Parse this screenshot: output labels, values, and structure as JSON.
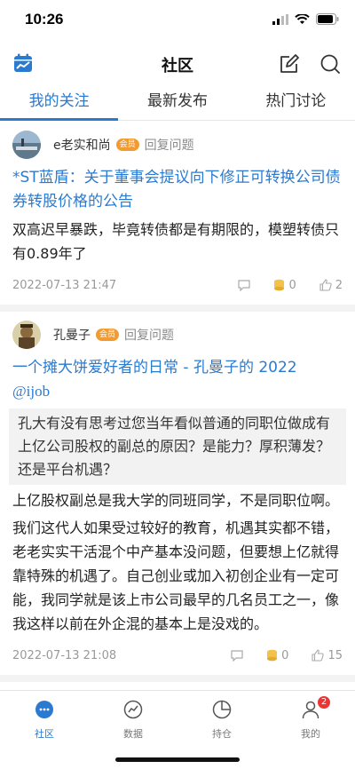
{
  "status_bar": {
    "time": "10:26"
  },
  "nav": {
    "title": "社区"
  },
  "tabs": [
    {
      "label": "我的关注",
      "active": true
    },
    {
      "label": "最新发布",
      "active": false
    },
    {
      "label": "热门讨论",
      "active": false
    }
  ],
  "posts": [
    {
      "author": "e老实和尚",
      "badge": "会员",
      "action": "回复问题",
      "title": "*ST蓝盾：关于董事会提议向下修正可转换公司债券转股价格的公告",
      "body": "双高迟早暴跌，毕竟转债都是有期限的，模塑转债只有0.89年了",
      "date": "2022-07-13 21:47",
      "coin_count": "0",
      "like_count": "2"
    },
    {
      "author": "孔曼子",
      "badge": "会员",
      "action": "回复问题",
      "title": "一个摊大饼爱好者的日常 - 孔曼子的 2022",
      "subtitle": "@ijob",
      "quote": "孔大有没有思考过您当年看似普通的同职位做成有上亿公司股权的副总的原因？是能力？厚积薄发？还是平台机遇？",
      "body1": "上亿股权副总是我大学的同班同学，不是同职位啊。",
      "body2": "我们这代人如果受过较好的教育，机遇其实都不错，老老实实干活混个中产基本没问题，但要想上亿就得靠特殊的机遇了。自己创业或加入初创企业有一定可能，我同学就是该上市公司最早的几名员工之一，像我这样以前在外企混的基本上是没戏的。",
      "date": "2022-07-13 21:08",
      "coin_count": "0",
      "like_count": "15"
    }
  ],
  "tabbar": {
    "items": [
      {
        "label": "社区",
        "icon": "chat-bubble-icon",
        "active": true
      },
      {
        "label": "数据",
        "icon": "chart-trend-icon",
        "active": false
      },
      {
        "label": "持仓",
        "icon": "pie-chart-icon",
        "active": false
      },
      {
        "label": "我的",
        "icon": "person-icon",
        "active": false
      }
    ],
    "notification_count": "2"
  },
  "colors": {
    "accent": "#2a7ad1",
    "badge": "#f29b33",
    "notification": "#e33333"
  }
}
